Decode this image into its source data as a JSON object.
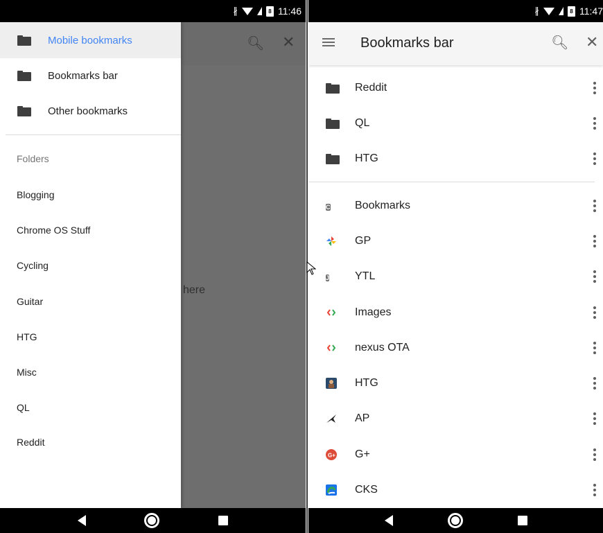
{
  "left": {
    "status_time": "11:46",
    "drawer": {
      "items": [
        {
          "label": "Mobile bookmarks",
          "selected": true
        },
        {
          "label": "Bookmarks bar",
          "selected": false
        },
        {
          "label": "Other bookmarks",
          "selected": false
        }
      ],
      "folders_header": "Folders",
      "folders": [
        "Blogging",
        "Chrome OS Stuff",
        "Cycling",
        "Guitar",
        "HTG",
        "Misc",
        "QL",
        "Reddit"
      ]
    },
    "scrim_text": "here"
  },
  "right": {
    "status_time": "11:47",
    "toolbar_title": "Bookmarks bar",
    "folders": [
      {
        "label": "Reddit",
        "icon": "folder-icon"
      },
      {
        "label": "QL",
        "icon": "folder-icon"
      },
      {
        "label": "HTG",
        "icon": "folder-icon"
      }
    ],
    "bookmarks": [
      {
        "label": "Bookmarks",
        "icon": "letter-c-favicon",
        "letter": "C"
      },
      {
        "label": "GP",
        "icon": "pinwheel-favicon"
      },
      {
        "label": "YTL",
        "icon": "letter-j-favicon",
        "letter": "J"
      },
      {
        "label": "Images",
        "icon": "code-brackets-favicon"
      },
      {
        "label": "nexus OTA",
        "icon": "code-brackets-favicon"
      },
      {
        "label": "HTG",
        "icon": "htg-favicon"
      },
      {
        "label": "AP",
        "icon": "arrow-logo-favicon"
      },
      {
        "label": "G+",
        "icon": "google-plus-favicon"
      },
      {
        "label": "CKS",
        "icon": "cks-favicon"
      }
    ]
  },
  "colors": {
    "accent_blue": "#4285f4",
    "status_bar": "#000000",
    "scrim": "#6e6e6e"
  }
}
